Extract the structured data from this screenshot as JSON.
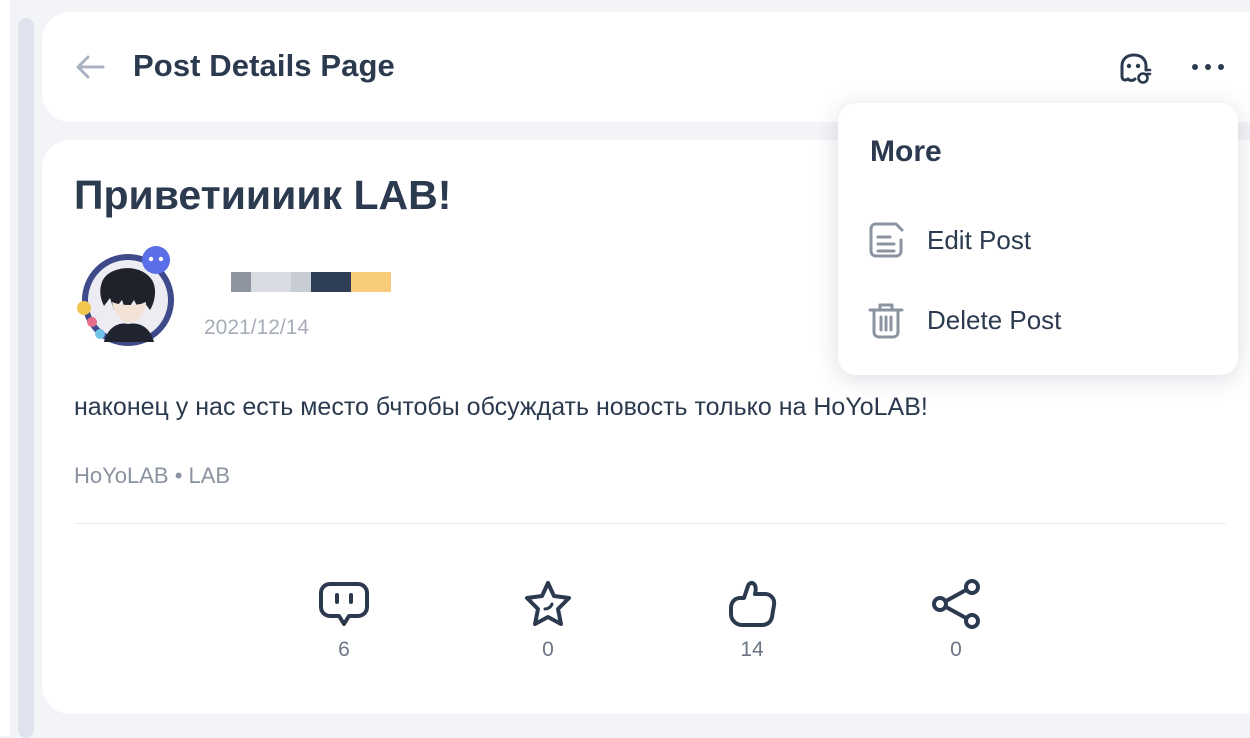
{
  "header": {
    "title": "Post Details Page",
    "back_icon": "arrow-left-icon",
    "bot_icon": "robot-settings-icon",
    "more_icon": "ellipsis-icon"
  },
  "post": {
    "title": "Приветиииик LAB!",
    "date": "2021/12/14",
    "body": "наконец у нас есть место бчтобы обсуждать  новость только на HoYoLAB!",
    "tags": "HoYoLAB • LAB",
    "username_redacted_colors": [
      "#8e95a1",
      "#d8dbe1",
      "#c8ccd3",
      "#2e3e56",
      "#f6cc7a"
    ]
  },
  "actions": [
    {
      "name": "comment",
      "icon": "comment-icon",
      "count": "6"
    },
    {
      "name": "favorite",
      "icon": "star-icon",
      "count": "0"
    },
    {
      "name": "like",
      "icon": "thumbs-up-icon",
      "count": "14"
    },
    {
      "name": "share",
      "icon": "share-icon",
      "count": "0"
    }
  ],
  "menu": {
    "title": "More",
    "items": [
      {
        "label": "Edit Post",
        "icon": "edit-icon"
      },
      {
        "label": "Delete Post",
        "icon": "trash-icon"
      }
    ]
  },
  "colors": {
    "background": "#f3f4f8",
    "card": "#ffffff",
    "text_primary": "#2b3a4f",
    "text_muted": "#a7adb8",
    "accent_blue": "#5a6ee8"
  }
}
